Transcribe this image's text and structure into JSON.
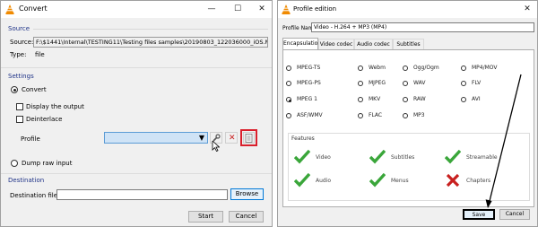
{
  "convert_window": {
    "title": "Convert",
    "source_section": "Source",
    "source_label": "Source:",
    "source_path": "F:\\$1441\\Internal\\TESTING11\\Testing files samples\\20190803_122036000_iOS.MOV",
    "type_label": "Type:",
    "type_value": "file",
    "settings_section": "Settings",
    "convert_option": "Convert",
    "display_output": "Display the output",
    "deinterlace": "Deinterlace",
    "profile_label": "Profile",
    "dump_raw": "Dump raw input",
    "destination_section": "Destination",
    "destination_label": "Destination file:",
    "destination_value": "",
    "browse_button": "Browse",
    "start_button": "Start",
    "cancel_button": "Cancel"
  },
  "profile_window": {
    "title": "Profile edition",
    "profile_name_label": "Profile Name",
    "profile_name_value": "Video - H.264 + MP3 (MP4)",
    "tabs": [
      "Encapsulation",
      "Video codec",
      "Audio codec",
      "Subtitles"
    ],
    "encapsulation_options": [
      {
        "label": "MPEG-TS",
        "selected": false
      },
      {
        "label": "Webm",
        "selected": false
      },
      {
        "label": "Ogg/Ogm",
        "selected": false
      },
      {
        "label": "MP4/MOV",
        "selected": false
      },
      {
        "label": "MPEG-PS",
        "selected": false
      },
      {
        "label": "MJPEG",
        "selected": false
      },
      {
        "label": "WAV",
        "selected": false
      },
      {
        "label": "FLV",
        "selected": false
      },
      {
        "label": "MPEG 1",
        "selected": true
      },
      {
        "label": "MKV",
        "selected": false
      },
      {
        "label": "RAW",
        "selected": false
      },
      {
        "label": "AVI",
        "selected": false
      },
      {
        "label": "ASF/WMV",
        "selected": false
      },
      {
        "label": "FLAC",
        "selected": false
      },
      {
        "label": "MP3",
        "selected": false
      }
    ],
    "features_section": "Features",
    "features": [
      {
        "label": "Video",
        "supported": true
      },
      {
        "label": "Subtitles",
        "supported": true
      },
      {
        "label": "Streamable",
        "supported": true
      },
      {
        "label": "Audio",
        "supported": true
      },
      {
        "label": "Menus",
        "supported": true
      },
      {
        "label": "Chapters",
        "supported": false
      }
    ],
    "save_button": "Save",
    "cancel_button": "Cancel"
  },
  "colors": {
    "highlight_red": "#d9202c",
    "check_green": "#3aa63a",
    "cross_red": "#c8201f",
    "vlc_orange": "#f08a00",
    "section_blue": "#1e3287"
  }
}
